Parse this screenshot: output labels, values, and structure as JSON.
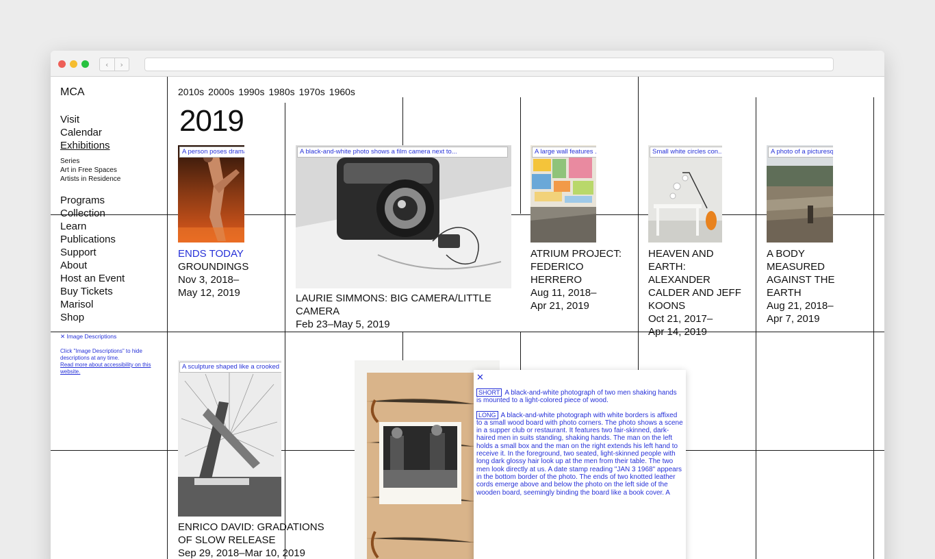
{
  "site": {
    "logo": "MCA",
    "nav_primary": [
      "Visit",
      "Calendar",
      "Exhibitions"
    ],
    "nav_sub": [
      "Series",
      "Art in Free Spaces",
      "Artists in Residence"
    ],
    "nav_secondary": [
      "Programs",
      "Collection",
      "Learn",
      "Publications",
      "Support",
      "About",
      "Host an Event",
      "Buy Tickets",
      "Marisol",
      "Shop"
    ],
    "image_descriptions_toggle": "✕ Image Descriptions",
    "image_descriptions_help": "Click \"Image Descriptions\" to hide descriptions at any time.",
    "image_descriptions_link": "Read more about accessibility on this website."
  },
  "timeline": {
    "decades": [
      "2010s",
      "2000s",
      "1990s",
      "1980s",
      "1970s",
      "1960s"
    ],
    "year": "2019"
  },
  "exhibitions": [
    {
      "alt": "A person poses dramat...",
      "status": "ENDS TODAY",
      "title": "GROUNDINGS",
      "dates_1": "Nov 3, 2018–",
      "dates_2": "May 12, 2019"
    },
    {
      "alt": "A black-and-white photo shows a film camera next to...",
      "title_1": "LAURIE SIMMONS: BIG CAMERA/LITTLE",
      "title_2": "CAMERA",
      "dates": "Feb 23–May 5, 2019"
    },
    {
      "alt": "A large wall features ...",
      "title_1": "ATRIUM PROJECT:",
      "title_2": "FEDERICO",
      "title_3": "HERRERO",
      "dates_1": "Aug 11, 2018–",
      "dates_2": "Apr 21, 2019"
    },
    {
      "alt": "Small white circles con...",
      "title_1": "HEAVEN AND",
      "title_2": "EARTH:",
      "title_3": "ALEXANDER",
      "title_4": "CALDER AND JEFF",
      "title_5": "KOONS",
      "dates_1": "Oct 21, 2017–",
      "dates_2": "Apr 14, 2019"
    },
    {
      "alt": "A photo of a picturesq...",
      "title_1": "A BODY",
      "title_2": "MEASURED",
      "title_3": "AGAINST THE",
      "title_4": "EARTH",
      "dates_1": "Aug 21, 2018–",
      "dates_2": "Apr 7, 2019"
    },
    {
      "alt": "A sculpture shaped like a crooked lette...",
      "title_1": "ENRICO DAVID: GRADATIONS",
      "title_2": "OF SLOW RELEASE",
      "dates": "Sep 29, 2018–Mar 10, 2019"
    }
  ],
  "description_panel": {
    "close": "✕",
    "short_tag": "SHORT",
    "short_text": "A black-and-white photograph of two men shaking hands is mounted to a light-colored piece of wood.",
    "long_tag": "LONG",
    "long_text": "A black-and-white photograph with white borders is affixed to a small wood board with photo corners. The photo shows a scene in a supper club or restaurant. It features two fair-skinned, dark-haired men in suits standing, shaking hands. The man on the left holds a small box and the man on the right extends his left hand to receive it. In the foreground, two seated, light-skinned people with long dark glossy hair look up at the men from their table. The two men look directly at us. A date stamp reading \"JAN 3 1968\" appears in the bottom border of the photo. The ends of two knotted leather cords emerge above and below the photo on the left side of the wooden board, seemingly binding the board like a book cover. A"
  },
  "colors": {
    "accent": "#2631d8",
    "line": "#1a1a1a"
  }
}
